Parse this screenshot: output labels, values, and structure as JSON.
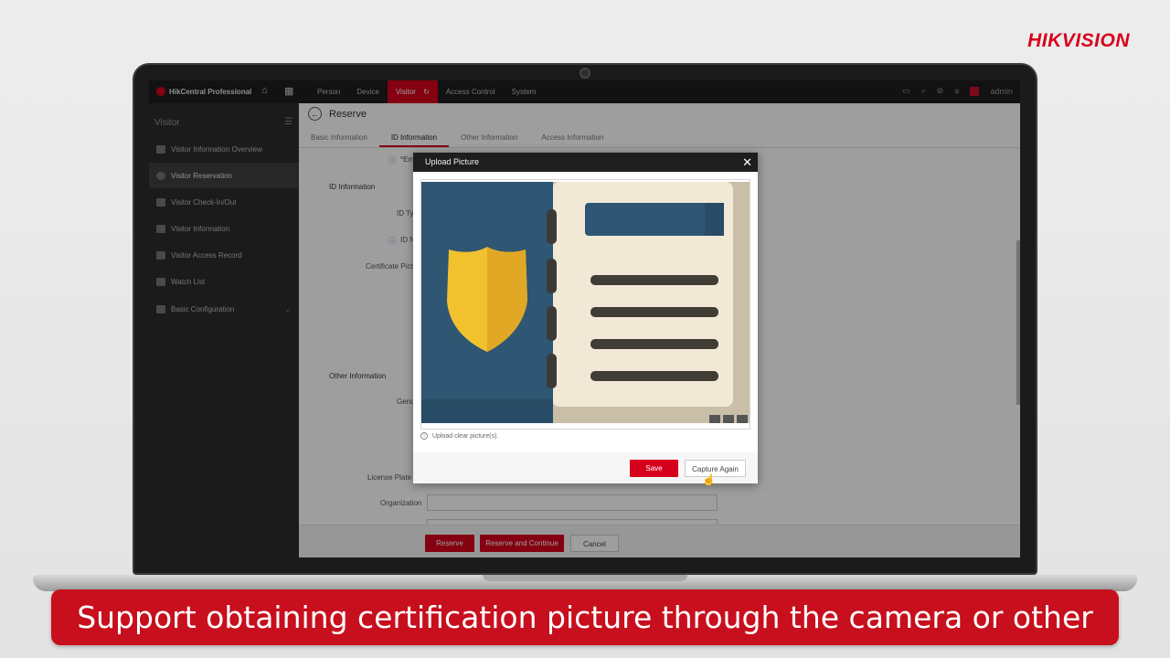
{
  "brand": "HIKVISION",
  "app": {
    "title": "HikCentral Professional",
    "nav": [
      "Person",
      "Device",
      "Visitor",
      "Access Control",
      "System"
    ],
    "nav_active": "Visitor",
    "user": "admin"
  },
  "sidebar": {
    "title": "Visitor",
    "items": [
      {
        "label": "Visitor Information Overview"
      },
      {
        "label": "Visitor Reservation"
      },
      {
        "label": "Visitor Check-In/Out"
      },
      {
        "label": "Visitor Information"
      },
      {
        "label": "Visitor Access Record"
      },
      {
        "label": "Watch List"
      },
      {
        "label": "Basic Configuration"
      }
    ],
    "active_item": "Visitor Reservation"
  },
  "page": {
    "title": "Reserve",
    "tabs": [
      "Basic Information",
      "ID Information",
      "Other Information",
      "Access Information"
    ],
    "active_tab": "ID Information"
  },
  "form": {
    "partial_label_top": "*Em",
    "id_information": "ID Information",
    "id_type": "ID Ty",
    "id_no": "ID N",
    "certificate_picture": "Certificate Pictu",
    "other_information": "Other Information",
    "gender": "Gend",
    "license_plate": "License Plate N",
    "organization": "Organization"
  },
  "buttons": {
    "reserve": "Reserve",
    "reserve_continue": "Reserve and Continue",
    "cancel": "Cancel"
  },
  "dialog": {
    "title": "Upload Picture",
    "hint": "Upload clear picture(s).",
    "save": "Save",
    "capture_again": "Capture Again"
  },
  "caption": "Support obtaining certification picture through the camera or other devices.",
  "colors": {
    "accent": "#d7001c",
    "caption_bg": "#c80f1d",
    "id_card_blue": "#2f5673",
    "id_card_paper": "#f1e9d6",
    "badge_yellow": "#f2c12e"
  }
}
